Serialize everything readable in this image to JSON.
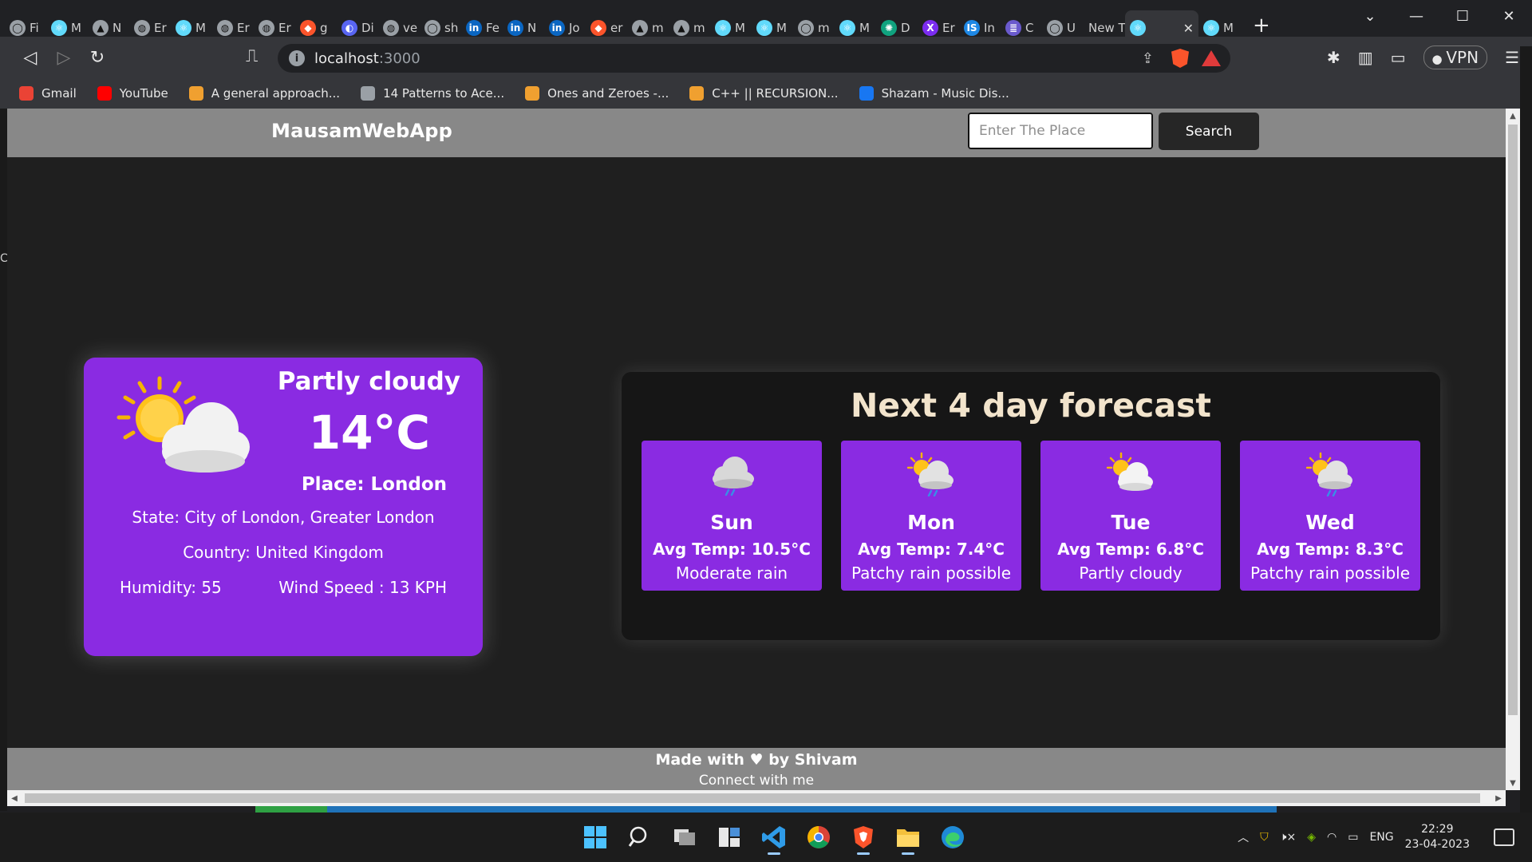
{
  "browser": {
    "tabs": [
      {
        "label": "Fi",
        "icon": "github-icon"
      },
      {
        "label": "M",
        "icon": "react-icon"
      },
      {
        "label": "N",
        "icon": "vercel-icon"
      },
      {
        "label": "Er",
        "icon": "globe-icon"
      },
      {
        "label": "M",
        "icon": "react-icon"
      },
      {
        "label": "Er",
        "icon": "globe-icon"
      },
      {
        "label": "Er",
        "icon": "globe-icon"
      },
      {
        "label": "g",
        "icon": "brave-shield-icon"
      },
      {
        "label": "Di",
        "icon": "discord-icon"
      },
      {
        "label": "ve",
        "icon": "globe-icon"
      },
      {
        "label": "sh",
        "icon": "github-icon"
      },
      {
        "label": "Fe",
        "icon": "linkedin-icon"
      },
      {
        "label": "N",
        "icon": "linkedin-icon"
      },
      {
        "label": "Jo",
        "icon": "linkedin-icon"
      },
      {
        "label": "er",
        "icon": "brave-shield-icon"
      },
      {
        "label": "m",
        "icon": "vercel-icon"
      },
      {
        "label": "m",
        "icon": "vercel-icon"
      },
      {
        "label": "M",
        "icon": "react-icon"
      },
      {
        "label": "M",
        "icon": "react-icon"
      },
      {
        "label": "m",
        "icon": "github-icon"
      },
      {
        "label": "M",
        "icon": "react-icon"
      },
      {
        "label": "D",
        "icon": "chatgpt-icon"
      },
      {
        "label": "Er",
        "icon": "x-icon"
      },
      {
        "label": "In",
        "icon": "is-icon"
      },
      {
        "label": "C",
        "icon": "list-icon"
      },
      {
        "label": "U",
        "icon": "github-icon"
      },
      {
        "label": "New T",
        "icon": ""
      }
    ],
    "active_tab": {
      "label": "",
      "icon": "react-icon"
    },
    "extra_tab": {
      "label": "M",
      "icon": "react-icon"
    },
    "url_host": "localhost",
    "url_port": ":3000",
    "vpn_label": "VPN",
    "bookmarks": [
      {
        "label": "Gmail",
        "icon": "gmail-icon",
        "color": "#ea4335"
      },
      {
        "label": "YouTube",
        "icon": "youtube-icon",
        "color": "#ff0000"
      },
      {
        "label": "A general approach...",
        "icon": "leetcode-icon",
        "color": "#f0a030"
      },
      {
        "label": "14 Patterns to Ace...",
        "icon": "globe-icon",
        "color": "#9aa0a6"
      },
      {
        "label": "Ones and Zeroes -...",
        "icon": "leetcode-icon",
        "color": "#f0a030"
      },
      {
        "label": "C++ || RECURSION...",
        "icon": "leetcode-icon",
        "color": "#f0a030"
      },
      {
        "label": "Shazam - Music Dis...",
        "icon": "shazam-icon",
        "color": "#1877f2"
      }
    ]
  },
  "app": {
    "brand": "MausamWebApp",
    "search_placeholder": "Enter The Place",
    "search_label": "Search",
    "current": {
      "condition": "Partly cloudy",
      "temp": "14°C",
      "place": "Place: London",
      "state": "State: City of London, Greater London",
      "country": "Country: United Kingdom",
      "humidity": "Humidity: 55",
      "wind": "Wind Speed : 13 KPH",
      "icon": "partly-cloudy-icon"
    },
    "forecast_title": "Next 4 day forecast",
    "forecast": [
      {
        "day": "Sun",
        "avg": "Avg Temp: 10.5°C",
        "desc": "Moderate rain",
        "icon": "rain-cloud-icon"
      },
      {
        "day": "Mon",
        "avg": "Avg Temp: 7.4°C",
        "desc": "Patchy rain possible",
        "icon": "sun-rain-cloud-icon"
      },
      {
        "day": "Tue",
        "avg": "Avg Temp: 6.8°C",
        "desc": "Partly cloudy",
        "icon": "partly-cloudy-icon"
      },
      {
        "day": "Wed",
        "avg": "Avg Temp: 8.3°C",
        "desc": "Patchy rain possible",
        "icon": "sun-rain-cloud-icon"
      }
    ],
    "footer_made": "Made with ♥ by Shivam",
    "footer_connect": "Connect with me"
  },
  "taskbar": {
    "apps": [
      "windows-start-icon",
      "search-icon",
      "task-view-icon",
      "widgets-icon",
      "vscode-icon",
      "chrome-icon",
      "brave-icon",
      "file-explorer-icon",
      "edge-icon"
    ],
    "lang": "ENG",
    "time": "22:29",
    "date": "23-04-2023"
  },
  "colors": {
    "accent": "#8a2be2",
    "header": "#888888",
    "page": "#1f1f1f",
    "forecast_title": "#f2e4cc"
  }
}
